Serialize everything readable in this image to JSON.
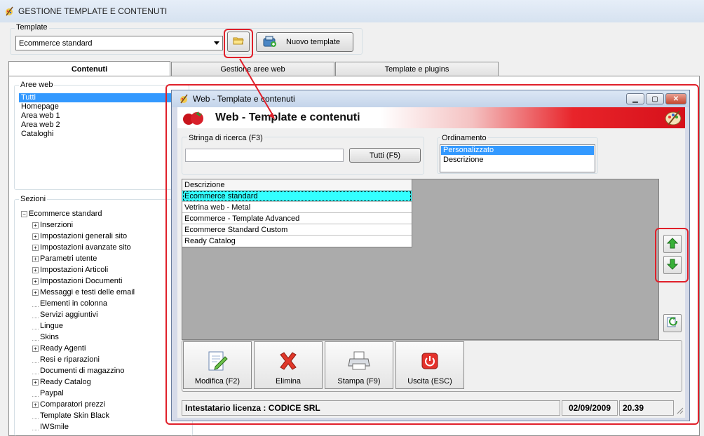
{
  "window": {
    "title": "GESTIONE TEMPLATE E CONTENUTI"
  },
  "template_group": {
    "label": "Template",
    "selected": "Ecommerce standard",
    "new_button_label": "Nuovo template"
  },
  "tabs": [
    "Contenuti",
    "Gestione aree web",
    "Template e plugins"
  ],
  "aree_web": {
    "label": "Aree web",
    "items": [
      "Tutti",
      "Homepage",
      "Area web 1",
      "Area web 2",
      "Cataloghi"
    ]
  },
  "sezioni": {
    "label": "Sezioni",
    "root": "Ecommerce standard",
    "items": [
      {
        "label": "Inserzioni",
        "expandable": true
      },
      {
        "label": "Impostazioni generali sito",
        "expandable": true
      },
      {
        "label": "Impostazioni avanzate sito",
        "expandable": true
      },
      {
        "label": "Parametri utente",
        "expandable": true
      },
      {
        "label": "Impostazioni Articoli",
        "expandable": true
      },
      {
        "label": "Impostazioni Documenti",
        "expandable": true
      },
      {
        "label": "Messaggi e testi delle email",
        "expandable": true
      },
      {
        "label": "Elementi in colonna",
        "expandable": false
      },
      {
        "label": "Servizi aggiuntivi",
        "expandable": false
      },
      {
        "label": "Lingue",
        "expandable": false
      },
      {
        "label": "Skins",
        "expandable": false
      },
      {
        "label": "Ready Agenti",
        "expandable": true
      },
      {
        "label": "Resi e riparazioni",
        "expandable": false
      },
      {
        "label": "Documenti di magazzino",
        "expandable": false
      },
      {
        "label": "Ready Catalog",
        "expandable": true
      },
      {
        "label": "Paypal",
        "expandable": false
      },
      {
        "label": "Comparatori prezzi",
        "expandable": true
      },
      {
        "label": "Template Skin Black",
        "expandable": false
      },
      {
        "label": "IWSmile",
        "expandable": false
      }
    ]
  },
  "dialog": {
    "title": "Web - Template e contenuti",
    "banner_title": "Web - Template e contenuti",
    "search": {
      "label": "Stringa di ricerca (F3)",
      "value": "",
      "button": "Tutti (F5)"
    },
    "ordinamento": {
      "label": "Ordinamento",
      "items": [
        "Personalizzato",
        "Descrizione"
      ]
    },
    "grid": {
      "header": "Descrizione",
      "rows": [
        "Ecommerce standard",
        "Vetrina web - Metal",
        "Ecommerce - Template Advanced",
        "Ecommerce Standard Custom",
        "Ready Catalog"
      ]
    },
    "buttons": {
      "modifica": "Modifica (F2)",
      "elimina": "Elimina",
      "stampa": "Stampa (F9)",
      "uscita": "Uscita (ESC)"
    },
    "status": {
      "license": "Intestatario licenza : CODICE SRL",
      "date": "02/09/2009",
      "time": "20.39"
    }
  },
  "colors": {
    "highlight_red": "#e0202a",
    "selection_blue": "#3399ff",
    "grid_selection": "#33ffff"
  }
}
